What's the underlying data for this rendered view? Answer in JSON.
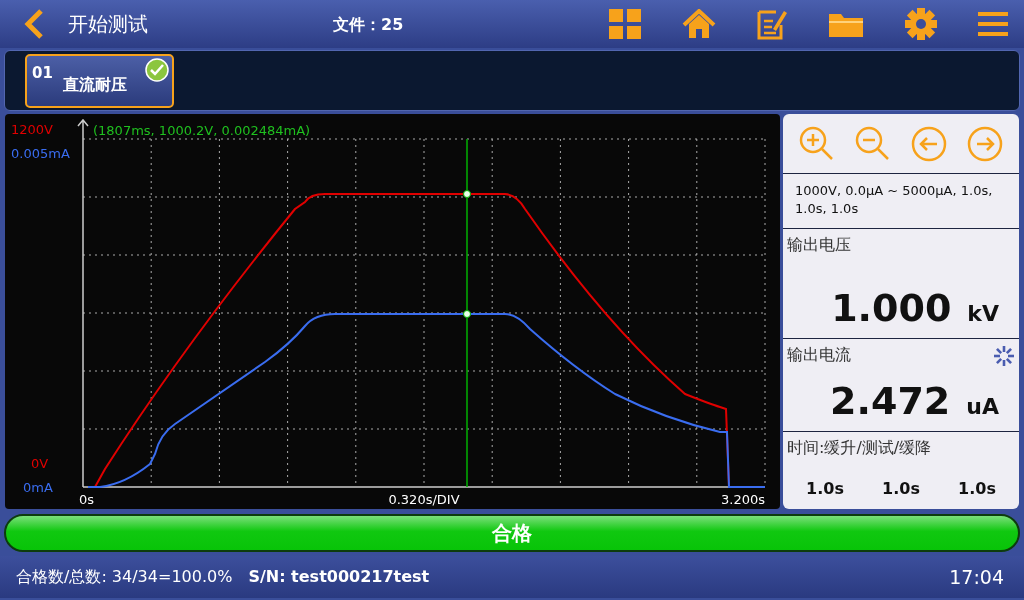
{
  "header": {
    "title": "开始测试",
    "file_label": "文件：25"
  },
  "tabs": [
    {
      "number": "01",
      "label": "直流耐压",
      "selected": true,
      "passed": true
    }
  ],
  "chart": {
    "cursor_readout": "(1807ms, 1000.2V, 0.002484mA)",
    "scale_labels": [
      {
        "text": "1200V",
        "color": "#e00000"
      },
      {
        "text": "0.005mA",
        "color": "#3a6df0"
      },
      {
        "text": "0V",
        "color": "#e00000"
      },
      {
        "text": "0mA",
        "color": "#3a6df0"
      }
    ],
    "x_labels": [
      "0s",
      "0.320s/DIV",
      "3.200s"
    ]
  },
  "readings": {
    "params": "1000V, 0.0μA ~ 5000μA, 1.0s, 1.0s, 1.0s",
    "voltage": {
      "label": "输出电压",
      "value": "1.000",
      "unit": "kV"
    },
    "current": {
      "label": "输出电流",
      "value": "2.472",
      "unit": "uA",
      "busy": true
    },
    "timing": {
      "label": "时间:缓升/测试/缓降",
      "values": [
        "1.0s",
        "1.0s",
        "1.0s"
      ]
    }
  },
  "result": {
    "text": "合格",
    "passed": true
  },
  "status_bar": {
    "summary": "合格数/总数: 34/34=100.0%",
    "serial": "S/N: test000217test",
    "time": "17:04"
  }
}
